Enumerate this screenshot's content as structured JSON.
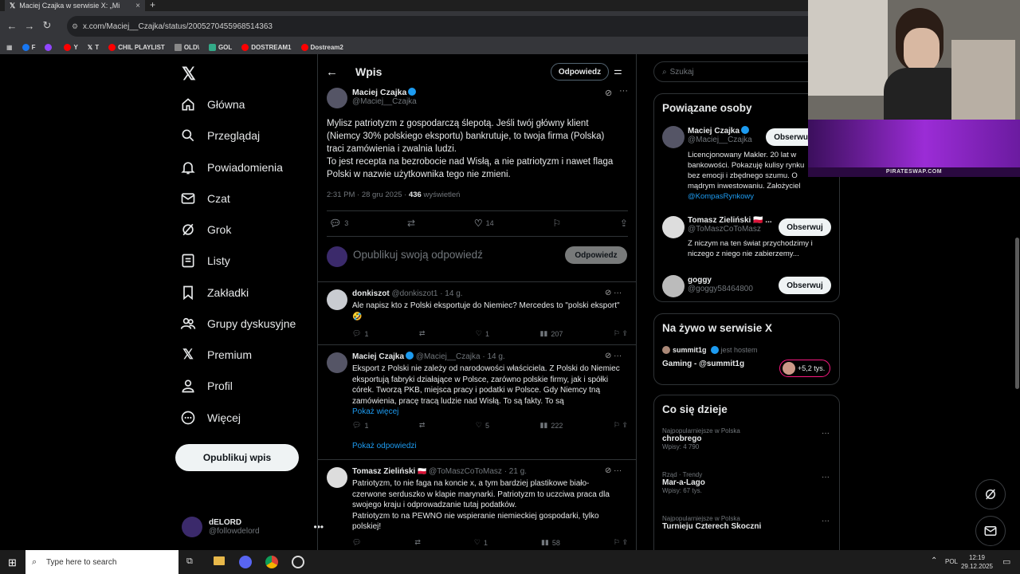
{
  "browser": {
    "tab_title": "Maciej Czajka w serwisie X: „Mi",
    "url": "x.com/Maciej__Czajka/status/2005270455968514363",
    "bookmarks": [
      "F",
      "",
      "Y",
      "T",
      "CHIL PLAYLIST",
      "OLD\\",
      "GOL",
      "DOSTREAM1",
      "Dostream2"
    ]
  },
  "sidebar": {
    "items": [
      {
        "label": "Główna",
        "icon": "home-icon"
      },
      {
        "label": "Przeglądaj",
        "icon": "search-icon"
      },
      {
        "label": "Powiadomienia",
        "icon": "bell-icon"
      },
      {
        "label": "Czat",
        "icon": "mail-icon"
      },
      {
        "label": "Grok",
        "icon": "grok-icon"
      },
      {
        "label": "Listy",
        "icon": "list-icon"
      },
      {
        "label": "Zakładki",
        "icon": "bookmark-icon"
      },
      {
        "label": "Grupy dyskusyjne",
        "icon": "people-icon"
      },
      {
        "label": "Premium",
        "icon": "x-logo-icon"
      },
      {
        "label": "Profil",
        "icon": "person-icon"
      },
      {
        "label": "Więcej",
        "icon": "more-circle-icon"
      }
    ],
    "post_button": "Opublikuj wpis",
    "account": {
      "name": "dELORD",
      "handle": "@followdelord"
    }
  },
  "header": {
    "title": "Wpis",
    "reply_button": "Odpowiedz"
  },
  "main_post": {
    "name": "Maciej Czajka",
    "handle": "@Maciej__Czajka",
    "lines": [
      "Mylisz patriotyzm z gospodarczą ślepotą. Jeśli twój główny klient",
      "(Niemcy 30% polskiego eksportu) bankrutuje, to twoja firma (Polska)",
      "traci zamówienia i zwalnia ludzi.",
      "To jest recepta na bezrobocie nad Wisłą, a nie patriotyzm i nawet flaga",
      "Polski w nazwie użytkownika tego nie zmieni."
    ],
    "time": "2:31 PM · 28 gru 2025 ·",
    "views": "436",
    "views_label": "wyświetleń",
    "replies": "3",
    "likes": "14"
  },
  "composer": {
    "placeholder": "Opublikuj swoją odpowiedź",
    "button": "Odpowiedz"
  },
  "replies": [
    {
      "name": "donkiszot",
      "meta": "@donkiszot1 · 14 g.",
      "lines": [
        "Ale napisz kto z Polski eksportuje do Niemiec? Mercedes to \"polski eksport\"",
        "🤣"
      ],
      "replies": "1",
      "likes": "1",
      "views": "207"
    },
    {
      "name": "Maciej Czajka",
      "meta": "@Maciej__Czajka · 14 g.",
      "lines": [
        "Eksport z Polski nie zależy od narodowości właściciela. Z Polski do Niemiec",
        "eksportują fabryki działające w Polsce, zarówno polskie firmy, jak i spółki",
        "córek. Tworzą PKB, miejsca pracy i podatki w Polsce. Gdy Niemcy tną",
        "zamówienia, pracę tracą ludzie nad Wisłą. To są fakty. To są"
      ],
      "show_more": "Pokaż więcej",
      "replies": "1",
      "likes": "5",
      "views": "222"
    },
    {
      "name": "Tomasz Zieliński",
      "meta": "@ToMaszCoToMasz · 21 g.",
      "lines": [
        "Patriotyzm, to nie faga na koncie x, a tym bardziej plastikowe biało-",
        "czerwone serduszko w klapie marynarki. Patriotyzm to uczciwa praca dla",
        "swojego kraju i odprowadzanie tutaj podatków.",
        "Patriotyzm to na PEWNO nie wspieranie niemieckiej gospodarki, tylko",
        "polskiej!"
      ],
      "replies": "",
      "likes": "1",
      "views": "58"
    }
  ],
  "show_replies": "Pokaż odpowiedzi",
  "right": {
    "search_placeholder": "Szukaj",
    "related_title": "Powiązane osoby",
    "people": [
      {
        "name": "Maciej Czajka",
        "handle": "@Maciej__Czajka",
        "button": "Obserwuj",
        "bio": [
          "Licencjonowany Makler. 20 lat w",
          "bankowości. Pokazuję kulisy rynku",
          "bez emocji i zbędnego szumu. O",
          "mądrym inwestowaniu. Założyciel"
        ],
        "link": "@KompasRynkowy"
      },
      {
        "name": "Tomasz Zieliński 🇵🇱 ...",
        "handle": "@ToMaszCoToMasz",
        "button": "Obserwuj",
        "bio": [
          "Z niczym na ten świat przychodzimy i",
          "niczego z niego nie zabierzemy..."
        ]
      },
      {
        "name": "goggy",
        "handle": "@goggy58464800",
        "button": "Obserwuj"
      }
    ],
    "live_title": "Na żywo w serwisie X",
    "live": {
      "host": "summit1g",
      "host_label": "jest hostem",
      "title": "Gaming - @summit1g",
      "count": "+5,2 tys."
    },
    "trends_title": "Co się dzieje",
    "trends": [
      {
        "cat": "Najpopularniejsze w Polska",
        "name": "chrobrego",
        "posts": "Wpisy: 4 790"
      },
      {
        "cat": "Rząd · Trendy",
        "name": "Mar-a-Lago",
        "posts": "Wpisy: 67 tys."
      },
      {
        "cat": "Najpopularniejsze w Polska",
        "name": "Turnieju Czterech Skoczni",
        "posts": ""
      }
    ]
  },
  "overlay": {
    "watermark": "PIRATESWAP.COM"
  },
  "taskbar": {
    "search": "Type here to search",
    "lang": "POL",
    "time": "12:19",
    "date": "29.12.2025"
  },
  "colors": {
    "accent": "#1d9bf0",
    "background": "#000000",
    "border": "#2f3336",
    "muted": "#71767b"
  }
}
